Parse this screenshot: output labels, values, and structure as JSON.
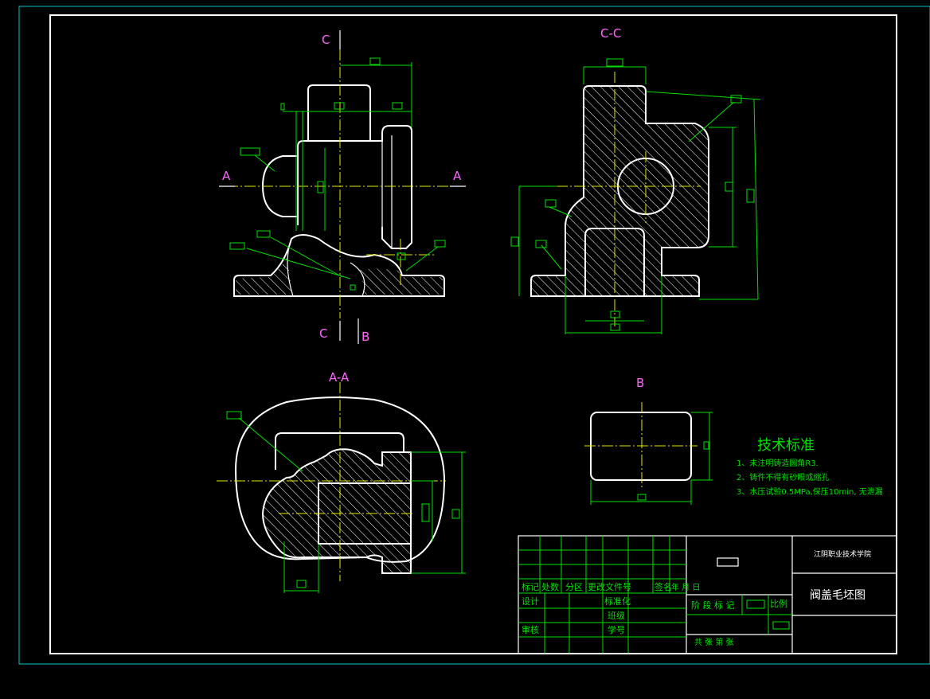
{
  "views": {
    "front": {
      "label_top": "C",
      "label_bottom": "C",
      "label_b": "B",
      "section_left": "A",
      "section_right": "A"
    },
    "section_cc": {
      "label": "C-C"
    },
    "section_aa": {
      "label": "A-A"
    },
    "view_b": {
      "label": "B"
    }
  },
  "tech": {
    "title": "技术标准",
    "items": [
      "1、未注明铸造圆角R3.",
      "2、铸件不得有砂眼或缩孔",
      "3、水压试验0.5MPa,保压10min, 无泄漏"
    ]
  },
  "title_block": {
    "school": "江阴职业技术学院",
    "drawing_title": "阀盖毛坯图",
    "header_cells": [
      "标记",
      "处数",
      "分区",
      "更改文件号",
      "签名",
      "年 月 日"
    ],
    "design": "设计",
    "standardize": "标准化",
    "audit": "审核",
    "class": "班级",
    "student_no": "学号",
    "stage": "阶 段 标 记",
    "scale": "比例",
    "sheets": "共  张  第  张"
  },
  "colors": {
    "frame": "#ffffff",
    "dimension": "#00e000",
    "center": "#e8e800",
    "border": "#00c8c8",
    "label": "#ff66ff"
  }
}
